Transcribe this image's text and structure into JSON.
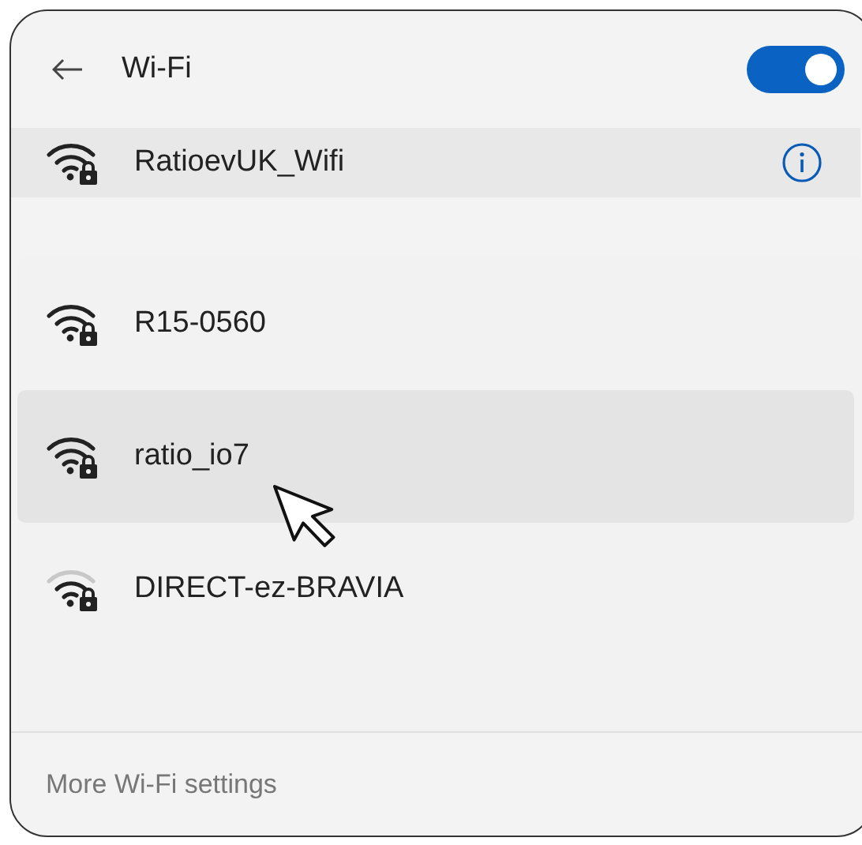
{
  "header": {
    "title": "Wi-Fi",
    "wifi_on": true
  },
  "connected": {
    "name": "RatioevUK_Wifi",
    "secured": true,
    "strong_signal": true
  },
  "networks": [
    {
      "name": "R15-0560",
      "secured": true,
      "strong_signal": true,
      "hovered": false
    },
    {
      "name": "ratio_io7",
      "secured": true,
      "strong_signal": true,
      "hovered": true
    },
    {
      "name": "DIRECT-ez-BRAVIA",
      "secured": true,
      "strong_signal": false,
      "hovered": false
    }
  ],
  "footer": {
    "link": "More Wi-Fi settings"
  }
}
